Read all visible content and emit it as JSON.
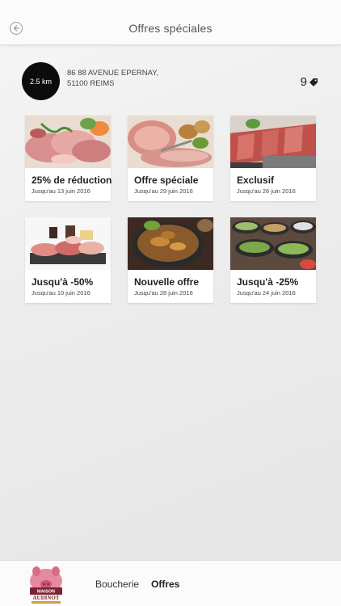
{
  "header": {
    "title": "Offres spéciales",
    "back_icon": "back-arrow-icon"
  },
  "store": {
    "distance": "2.5 km",
    "address_line1": "86 88 AVENUE EPERNAY,",
    "address_line2": "51100 REIMS",
    "offer_count": "9",
    "offer_icon": "tag-icon"
  },
  "offers": [
    {
      "title": "25% de réduction",
      "date": "Jusqu'au 13 juin 2016",
      "image": "ham-platter"
    },
    {
      "title": "Offre spéciale",
      "date": "Jusqu'au 29 juin 2016",
      "image": "roast-pork"
    },
    {
      "title": "Exclusif",
      "date": "Jusqu'au 26 juin 2016",
      "image": "sliced-beef"
    },
    {
      "title": "Jusqu'à -50%",
      "date": "Jusqu'au 10 juin 2016",
      "image": "charcuterie-board"
    },
    {
      "title": "Nouvelle offre",
      "date": "Jusqu'au 28 juin 2016",
      "image": "stew-pot"
    },
    {
      "title": "Jusqu'à -25%",
      "date": "Jusqu'au 24 juin 2016",
      "image": "buffet-dishes"
    }
  ],
  "footer": {
    "logo_text": "MAISON AUDINOT",
    "nav": [
      {
        "label": "Boucherie",
        "active": false
      },
      {
        "label": "Offres",
        "active": true
      }
    ]
  },
  "colors": {
    "badge": "#0c0c0c",
    "background": "#ececec"
  }
}
